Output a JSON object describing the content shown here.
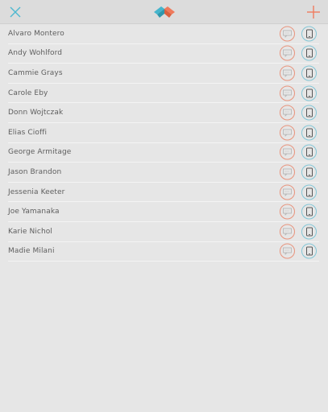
{
  "header": {
    "close_icon": "close-x-icon",
    "logo_icon": "app-logo-icon",
    "add_icon": "plus-icon",
    "colors": {
      "close": "#4fb8cf",
      "add": "#f07b5e",
      "logo_teal": "#45b5cc",
      "logo_coral": "#ef7a5c"
    }
  },
  "contacts": [
    {
      "name": "Alvaro Montero"
    },
    {
      "name": "Andy Wohlford"
    },
    {
      "name": "Cammie Grays"
    },
    {
      "name": "Carole Eby"
    },
    {
      "name": "Donn Wojtczak"
    },
    {
      "name": "Elias Cioffi"
    },
    {
      "name": "George Armitage"
    },
    {
      "name": "Jason Brandon"
    },
    {
      "name": "Jessenia Keeter"
    },
    {
      "name": "Joe Yamanaka"
    },
    {
      "name": "Karie Nichol"
    },
    {
      "name": "Madie Milani"
    }
  ],
  "row_actions": {
    "message_icon": "chat-bubble-icon",
    "phone_icon": "phone-icon",
    "message_color": "#e8937c",
    "phone_color": "#82c6d6"
  }
}
